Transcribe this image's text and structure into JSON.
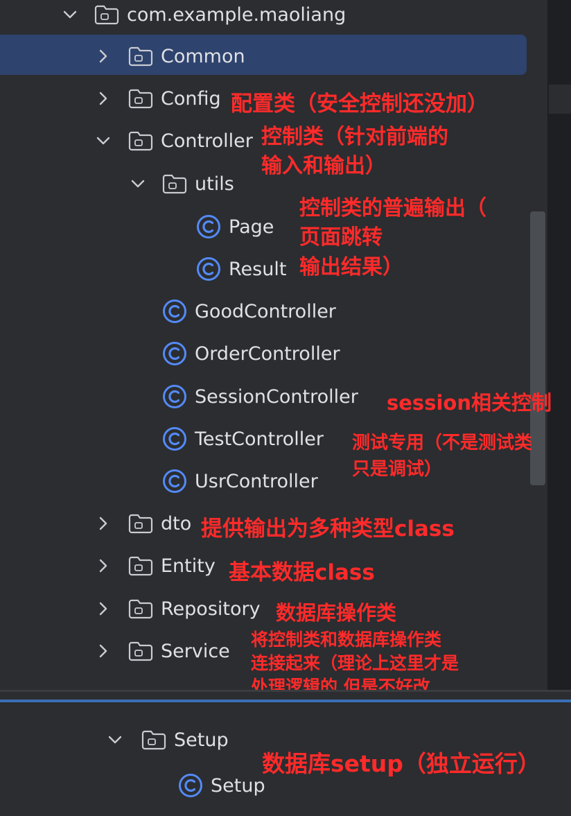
{
  "tree": {
    "package": "com.example.maoliang",
    "common": "Common",
    "config": "Config",
    "controller": "Controller",
    "utils": "utils",
    "page": "Page",
    "result": "Result",
    "good_controller": "GoodController",
    "order_controller": "OrderController",
    "session_controller": "SessionController",
    "test_controller": "TestController",
    "usr_controller": "UsrController",
    "dto": "dto",
    "entity": "Entity",
    "repository": "Repository",
    "service": "Service",
    "setup_folder": "Setup",
    "setup_class": "Setup"
  },
  "notes": {
    "config": "配置类（安全控制还没加）",
    "controller_1": "控制类（针对前端的",
    "controller_2": "输入和输出）",
    "utils_1": "控制类的普遍输出（",
    "utils_2": "页面跳转",
    "utils_3": "输出结果）",
    "session": "session相关控制",
    "test_1": "测试专用（不是测试类",
    "test_2": "只是调试）",
    "dto": "提供输出为多种类型class",
    "entity": "基本数据class",
    "repository": "数据库操作类",
    "service_1": "将控制类和数据库操作类",
    "service_2": "连接起来（理论上这里才是",
    "service_3": "处理逻辑的 但是不好改",
    "setup": "数据库setup（独立运行）"
  },
  "colors": {
    "background": "#2b2d30",
    "selection": "#2e436e",
    "annotation": "#ff2a2a",
    "class_icon": "#548af7"
  }
}
